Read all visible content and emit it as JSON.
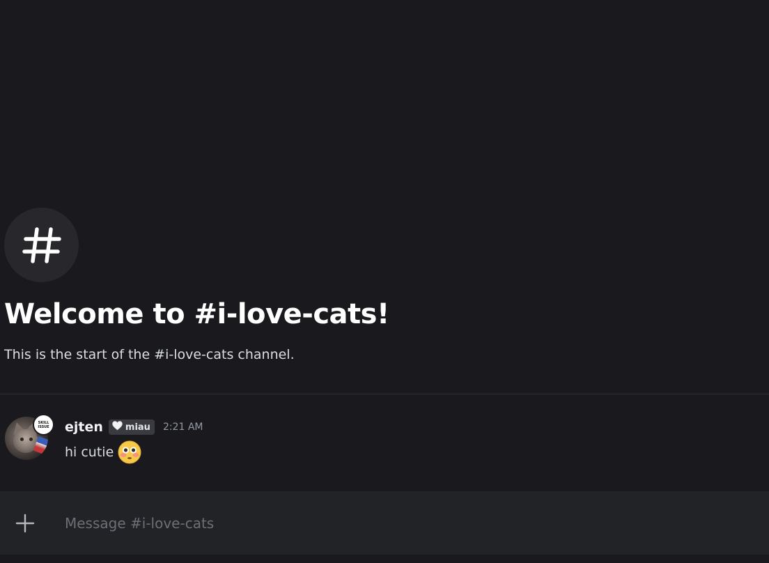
{
  "channel": {
    "icon": "hashtag-icon",
    "welcome_title": "Welcome to #i-love-cats!",
    "welcome_subtitle": "This is the start of the #i-love-cats channel."
  },
  "messages": [
    {
      "author": "ejten",
      "avatar_badge": [
        "SKILL",
        "ISSUE"
      ],
      "role_tag": {
        "icon": "white-heart-icon",
        "label": "miau"
      },
      "timestamp": "2:21 AM",
      "text": "hi cutie",
      "emoji": "flushed-face-emoji"
    }
  ],
  "composer": {
    "add_icon": "plus-icon",
    "placeholder": "Message #i-love-cats",
    "value": ""
  },
  "colors": {
    "background": "#1a1a1e",
    "composer_background": "#222327",
    "icon_circle": "#27272c",
    "text_primary": "#f2f3f5",
    "text_muted": "#949ba4",
    "role_tag_background": "#3a3b41"
  }
}
